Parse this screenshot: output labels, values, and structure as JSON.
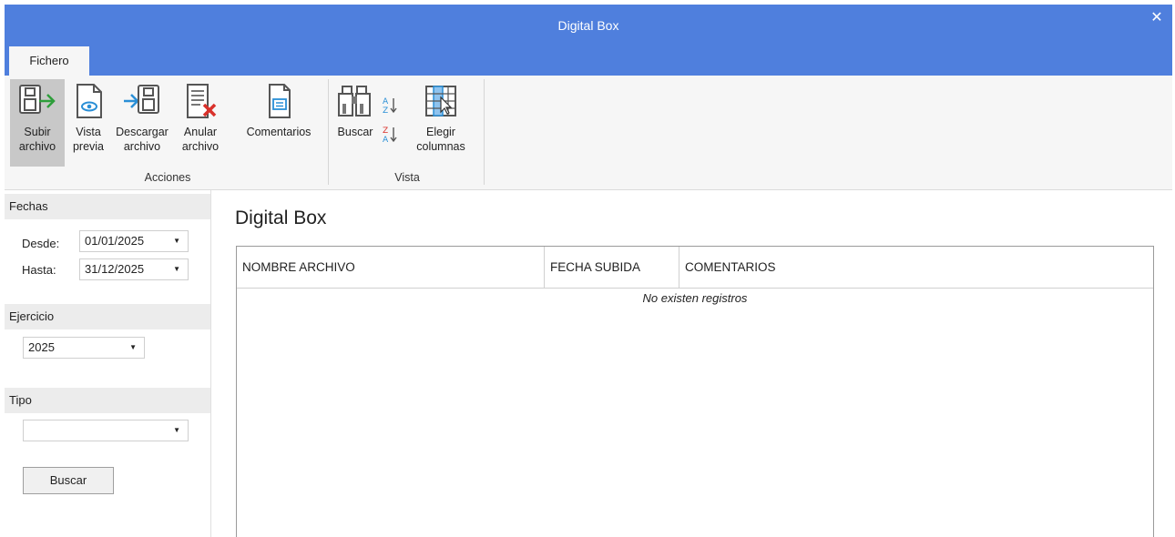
{
  "window": {
    "title": "Digital Box",
    "close_glyph": "✕"
  },
  "tabs": [
    {
      "label": "Fichero"
    }
  ],
  "ribbon": {
    "groups": [
      {
        "label": "Acciones",
        "buttons": [
          {
            "line1": "Subir",
            "line2": "archivo",
            "icon": "upload-file-icon"
          },
          {
            "line1": "Vista",
            "line2": "previa",
            "icon": "preview-icon"
          },
          {
            "line1": "Descargar",
            "line2": "archivo",
            "icon": "download-file-icon"
          },
          {
            "line1": "Anular",
            "line2": "archivo",
            "icon": "cancel-file-icon"
          },
          {
            "line1": "Comentarios",
            "line2": "",
            "icon": "comments-icon"
          }
        ]
      },
      {
        "label": "Vista",
        "buttons": [
          {
            "line1": "Buscar",
            "line2": "",
            "icon": "binoculars-icon"
          },
          {
            "line1": "Elegir",
            "line2": "columnas",
            "icon": "choose-columns-icon"
          }
        ],
        "sort_icons": [
          "sort-ascending-icon",
          "sort-descending-icon"
        ]
      }
    ]
  },
  "filters": {
    "fechas": {
      "header": "Fechas",
      "desde_label": "Desde:",
      "desde_value": "01/01/2025",
      "hasta_label": "Hasta:",
      "hasta_value": "31/12/2025"
    },
    "ejercicio": {
      "header": "Ejercicio",
      "value": "2025"
    },
    "tipo": {
      "header": "Tipo",
      "value": ""
    },
    "search_button": "Buscar"
  },
  "main": {
    "title": "Digital Box",
    "columns": [
      "NOMBRE ARCHIVO",
      "FECHA SUBIDA",
      "COMENTARIOS"
    ],
    "empty_message": "No existen registros"
  },
  "colors": {
    "titlebar": "#4f7fdd",
    "ribbon_bg": "#f6f6f6",
    "accent_green": "#2e9e3b",
    "accent_blue": "#2a8fd6",
    "accent_red": "#d9312b"
  }
}
